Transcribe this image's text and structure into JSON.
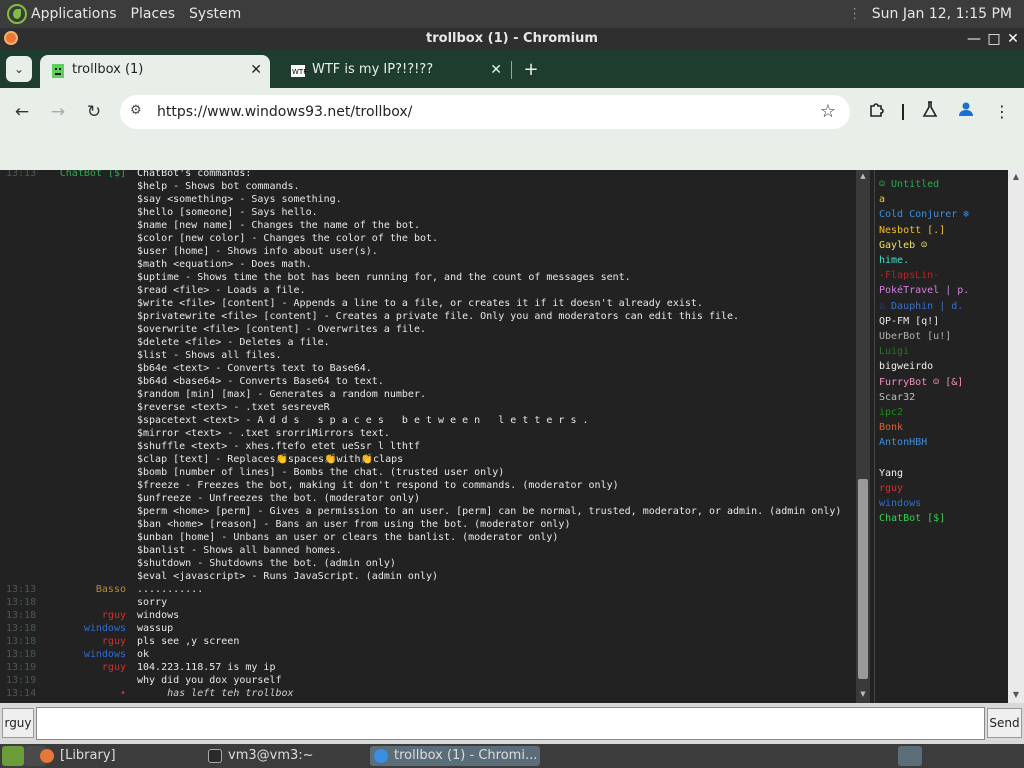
{
  "topbar": {
    "menus": [
      "Applications",
      "Places",
      "System"
    ],
    "clock": "Sun Jan 12,  1:15 PM"
  },
  "window": {
    "title": "trollbox (1) - Chromium",
    "min": "—",
    "max": "□",
    "close": "✕"
  },
  "tabs": [
    {
      "title": "trollbox (1)",
      "close": "✕"
    },
    {
      "title": "WTF is my IP?!?!??",
      "close": "✕"
    }
  ],
  "newtab": "+",
  "toolbar": {
    "back": "←",
    "forward": "→",
    "reload": "↻",
    "url": "https://www.windows93.net/trollbox/",
    "star": "☆",
    "site_icon": "⚙"
  },
  "chat": {
    "header_fragment": {
      "time": "13:13",
      "nick": "ChatBot [$]",
      "msg": "ChatBot's commands:"
    },
    "commands": [
      "$help - Shows bot commands.",
      "$say <something> - Says something.",
      "$hello [someone] - Says hello.",
      "$name [new name] - Changes the name of the bot.",
      "$color [new color] - Changes the color of the bot.",
      "$user [home] - Shows info about user(s).",
      "$math <equation> - Does math.",
      "$uptime - Shows time the bot has been running for, and the count of messages sent.",
      "$read <file> - Loads a file.",
      "$write <file> [content] - Appends a line to a file, or creates it if it doesn't already exist.",
      "$privatewrite <file> [content] - Creates a private file. Only you and moderators can edit this file.",
      "$overwrite <file> [content] - Overwrites a file.",
      "$delete <file> - Deletes a file.",
      "$list - Shows all files.",
      "$b64e <text> - Converts text to Base64.",
      "$b64d <base64> - Converts Base64 to text.",
      "$random [min] [max] - Generates a random number.",
      "$reverse <text> - .txet sesreveR",
      "$spacetext <text> - A d d s   s p a c e s   b e t w e e n   l e t t e r s .",
      "$mirror <text> - .txet srorriMirrors text.",
      "$shuffle <text> - xhes.ftefo etet ueSsr l lthtf",
      "$clap [text] - Replaces👏spaces👏with👏claps",
      "$bomb [number of lines] - Bombs the chat. (trusted user only)",
      "$freeze - Freezes the bot, making it don't respond to commands. (moderator only)",
      "$unfreeze - Unfreezes the bot. (moderator only)",
      "$perm <home> [perm] - Gives a permission to an user. [perm] can be normal, trusted, moderator, or admin. (admin only)",
      "$ban <home> [reason] - Bans an user from using the bot. (moderator only)",
      "$unban [home] - Unbans an user or clears the banlist. (moderator only)",
      "$banlist - Shows all banned homes.",
      "$shutdown - Shutdowns the bot. (admin only)",
      "$eval <javascript> - Runs JavaScript. (admin only)"
    ],
    "messages": [
      {
        "time": "13:13",
        "nick": "Basso",
        "color": "#b58a3a",
        "msg": "...........",
        "italic": false
      },
      {
        "time": "13:18",
        "nick": "",
        "color": "#e0e0e0",
        "msg": "sorry",
        "italic": false
      },
      {
        "time": "13:18",
        "nick": "rguy",
        "color": "#d03030",
        "msg": "windows",
        "italic": false
      },
      {
        "time": "13:18",
        "nick": "windows",
        "color": "#2d6fd6",
        "msg": "wassup",
        "italic": false
      },
      {
        "time": "13:18",
        "nick": "rguy",
        "color": "#d03030",
        "msg": "pls see ,y screen",
        "italic": false
      },
      {
        "time": "13:18",
        "nick": "windows",
        "color": "#2d6fd6",
        "msg": "ok",
        "italic": false
      },
      {
        "time": "13:19",
        "nick": "rguy",
        "color": "#d03030",
        "msg": "104.223.118.57 is my ip",
        "italic": false
      },
      {
        "time": "13:19",
        "nick": "",
        "color": "#e0e0e0",
        "msg": "why did you dox yourself",
        "italic": false
      },
      {
        "time": "13:14",
        "nick": "•",
        "color": "#d03030",
        "msg": "     has left teh trollbox",
        "italic": true
      }
    ]
  },
  "users": [
    {
      "name": "☺ Untitled",
      "color": "#2fa84f"
    },
    {
      "name": "a",
      "color": "#e8d020"
    },
    {
      "name": "Cold Conjurer ❄",
      "color": "#3a8fe0"
    },
    {
      "name": "Nesbott [.]",
      "color": "#f0c020"
    },
    {
      "name": "Gayleb ☺",
      "color": "#f0e060"
    },
    {
      "name": "hime.",
      "color": "#40e0d0"
    },
    {
      "name": "-FlapsLin-",
      "color": "#c02020"
    },
    {
      "name": "PokéTravel | p.",
      "color": "#d080e0"
    },
    {
      "name": "♘ Dauphin | d.",
      "color": "#3a70d0"
    },
    {
      "name": "QP-FM [q!]",
      "color": "#e8e8e8"
    },
    {
      "name": "UberBot [u!]",
      "color": "#b0b0b0"
    },
    {
      "name": "Luigi",
      "color": "#207a20"
    },
    {
      "name": "bigweirdo",
      "color": "#f0f0f0"
    },
    {
      "name": "FurryBot ☺ [&]",
      "color": "#f090c0"
    },
    {
      "name": "Scar32",
      "color": "#c0c0c0"
    },
    {
      "name": "ipc2",
      "color": "#208a20"
    },
    {
      "name": "Bonk",
      "color": "#e06030"
    },
    {
      "name": "AntonHBH",
      "color": "#3a90e0"
    },
    {
      "name": "",
      "color": "#e0e0e0"
    },
    {
      "name": "Yang",
      "color": "#f0f0f0"
    },
    {
      "name": "rguy",
      "color": "#d03030"
    },
    {
      "name": "windows",
      "color": "#2d6fd6"
    },
    {
      "name": "ChatBot [$]",
      "color": "#30d050"
    }
  ],
  "input": {
    "nick": "rguy",
    "placeholder": "",
    "send": "Send"
  },
  "taskbar": [
    {
      "label": "[Library]",
      "icon_color": "#e8773a"
    },
    {
      "label": "vm3@vm3:~",
      "icon_color": "#2a2a2a"
    },
    {
      "label": "trollbox (1) - Chromi...",
      "icon_color": "#3a8fe0"
    }
  ]
}
